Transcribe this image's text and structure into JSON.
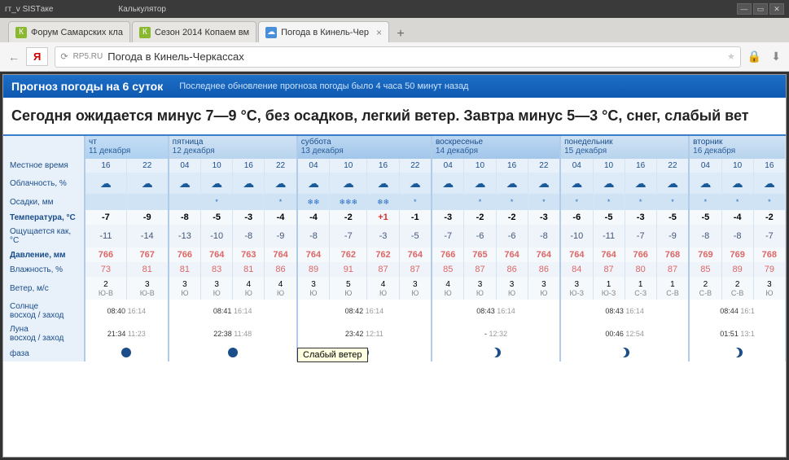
{
  "titlebar": {
    "left1": "гт_v SISTаке",
    "left2": "Калькулятор"
  },
  "tabs": [
    {
      "favicon": "К",
      "fav_bg": "#8ab82f",
      "title": "Форум Самарских кла",
      "active": false
    },
    {
      "favicon": "К",
      "fav_bg": "#8ab82f",
      "title": "Сезон 2014 Копаем вм",
      "active": false
    },
    {
      "favicon": "☁",
      "fav_bg": "#4a90d9",
      "title": "Погода в Кинель-Чер",
      "active": true
    }
  ],
  "address": {
    "domain": "RP5.RU",
    "title": "Погода в Кинель-Черкассах"
  },
  "header": {
    "title": "Прогноз погоды на 6 суток",
    "update": "Последнее обновление прогноза погоды было 4 часа 50 минут назад"
  },
  "summary": "Сегодня ожидается минус 7—9 °C, без осадков, легкий ветер. Завтра минус 5—3 °C, снег, слабый вет",
  "tooltip": "Слабый ветер",
  "row_labels": {
    "time": "Местное время",
    "clouds": "Облачность, %",
    "precip": "Осадки, мм",
    "temp": "Температура, °C",
    "feels": "Ощущается как, °C",
    "pressure": "Давление, мм",
    "humid": "Влажность, %",
    "wind": "Ветер, м/с",
    "sun": "Солнце\nвосход / заход",
    "moon": "Луна\nвосход / заход",
    "phase": "фаза"
  },
  "days": [
    {
      "name": "чт",
      "date": "11 декабря",
      "weekend": false,
      "cols": 2
    },
    {
      "name": "пятница",
      "date": "12 декабря",
      "weekend": false,
      "cols": 4
    },
    {
      "name": "суббота",
      "date": "13 декабря",
      "weekend": true,
      "cols": 4
    },
    {
      "name": "воскресенье",
      "date": "14 декабря",
      "weekend": true,
      "cols": 4
    },
    {
      "name": "понедельник",
      "date": "15 декабря",
      "weekend": false,
      "cols": 4
    },
    {
      "name": "вторник",
      "date": "16 декабря",
      "weekend": false,
      "cols": 3
    }
  ],
  "sun": [
    {
      "rise": "08:40",
      "set": "16:14"
    },
    {
      "rise": "08:41",
      "set": "16:14"
    },
    {
      "rise": "08:42",
      "set": "16:14"
    },
    {
      "rise": "08:43",
      "set": "16:14"
    },
    {
      "rise": "08:43",
      "set": "16:14"
    },
    {
      "rise": "08:44",
      "set": "16:1"
    }
  ],
  "moon": [
    {
      "rise": "21:34",
      "set": "11:23"
    },
    {
      "rise": "22:38",
      "set": "11:48"
    },
    {
      "rise": "23:42",
      "set": "12:11"
    },
    {
      "rise": "-",
      "set": "12:32"
    },
    {
      "rise": "00:46",
      "set": "12:54"
    },
    {
      "rise": "01:51",
      "set": "13:1"
    }
  ],
  "hours": [
    "16",
    "22",
    "04",
    "10",
    "16",
    "22",
    "04",
    "10",
    "16",
    "22",
    "04",
    "10",
    "16",
    "22",
    "04",
    "10",
    "16",
    "22",
    "04",
    "10",
    "16"
  ],
  "precip": [
    "",
    "",
    "",
    "*",
    "",
    "*",
    "❄❄",
    "❄❄❄",
    "❄❄",
    "*",
    "",
    "*",
    "*",
    "*",
    "*",
    "*",
    "*",
    "*",
    "*",
    "*",
    "*"
  ],
  "temp": [
    "-7",
    "-9",
    "-8",
    "-5",
    "-3",
    "-4",
    "-4",
    "-2",
    "+1",
    "-1",
    "-3",
    "-2",
    "-2",
    "-3",
    "-6",
    "-5",
    "-3",
    "-5",
    "-5",
    "-4",
    "-2"
  ],
  "feels": [
    "-11",
    "-14",
    "-13",
    "-10",
    "-8",
    "-9",
    "-8",
    "-7",
    "-3",
    "-5",
    "-7",
    "-6",
    "-6",
    "-8",
    "-10",
    "-11",
    "-7",
    "-9",
    "-8",
    "-8",
    "-7"
  ],
  "pressure": [
    "766",
    "767",
    "766",
    "764",
    "763",
    "764",
    "764",
    "762",
    "762",
    "764",
    "766",
    "765",
    "764",
    "764",
    "764",
    "764",
    "766",
    "768",
    "769",
    "769",
    "768"
  ],
  "humid": [
    "73",
    "81",
    "81",
    "83",
    "81",
    "86",
    "89",
    "91",
    "87",
    "87",
    "85",
    "87",
    "86",
    "86",
    "84",
    "87",
    "80",
    "87",
    "85",
    "89",
    "79"
  ],
  "wind_val": [
    "2",
    "3",
    "3",
    "3",
    "4",
    "4",
    "3",
    "5",
    "4",
    "3",
    "4",
    "3",
    "3",
    "3",
    "3",
    "1",
    "1",
    "1",
    "2",
    "2",
    "3"
  ],
  "wind_dir": [
    "Ю-В",
    "Ю-В",
    "Ю",
    "Ю",
    "Ю",
    "Ю",
    "Ю",
    "Ю",
    "Ю",
    "Ю",
    "Ю",
    "Ю",
    "Ю",
    "Ю",
    "Ю-З",
    "Ю-З",
    "С-З",
    "С-В",
    "С-В",
    "С-В",
    "Ю"
  ],
  "chart_data": {
    "type": "table",
    "title": "Прогноз погоды на 6 суток — Кинель-Черкассы",
    "xlabel": "Местное время (час)",
    "series": [
      {
        "name": "Температура, °C",
        "values": [
          -7,
          -9,
          -8,
          -5,
          -3,
          -4,
          -4,
          -2,
          1,
          -1,
          -3,
          -2,
          -2,
          -3,
          -6,
          -5,
          -3,
          -5,
          -5,
          -4,
          -2
        ]
      },
      {
        "name": "Ощущается как, °C",
        "values": [
          -11,
          -14,
          -13,
          -10,
          -8,
          -9,
          -8,
          -7,
          -3,
          -5,
          -7,
          -6,
          -6,
          -8,
          -10,
          -11,
          -7,
          -9,
          -8,
          -8,
          -7
        ]
      },
      {
        "name": "Давление, мм",
        "values": [
          766,
          767,
          766,
          764,
          763,
          764,
          764,
          762,
          762,
          764,
          766,
          765,
          764,
          764,
          764,
          764,
          766,
          768,
          769,
          769,
          768
        ]
      },
      {
        "name": "Влажность, %",
        "values": [
          73,
          81,
          81,
          83,
          81,
          86,
          89,
          91,
          87,
          87,
          85,
          87,
          86,
          86,
          84,
          87,
          80,
          87,
          85,
          89,
          79
        ]
      },
      {
        "name": "Ветер, м/с",
        "values": [
          2,
          3,
          3,
          3,
          4,
          4,
          3,
          5,
          4,
          3,
          4,
          3,
          3,
          3,
          3,
          1,
          1,
          1,
          2,
          2,
          3
        ]
      }
    ],
    "categories": [
      "16",
      "22",
      "04",
      "10",
      "16",
      "22",
      "04",
      "10",
      "16",
      "22",
      "04",
      "10",
      "16",
      "22",
      "04",
      "10",
      "16",
      "22",
      "04",
      "10",
      "16"
    ]
  }
}
